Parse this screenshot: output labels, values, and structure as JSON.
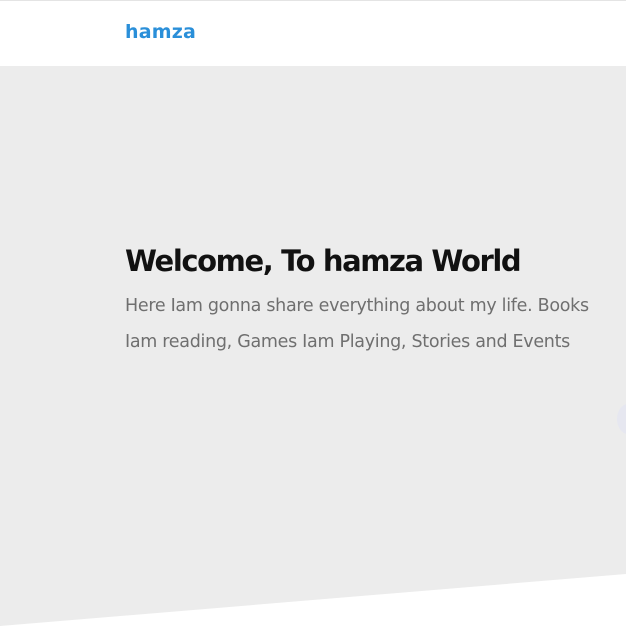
{
  "navbar": {
    "brand": "hamza"
  },
  "hero": {
    "title": "Welcome, To hamza World",
    "description": "Here Iam gonna share everything about my life. Books Iam reading, Games Iam Playing, Stories and Events"
  },
  "colors": {
    "brand": "#2a8fd9",
    "hero_background": "#ececec",
    "title": "#111111",
    "body_text": "#6f6f6f"
  }
}
